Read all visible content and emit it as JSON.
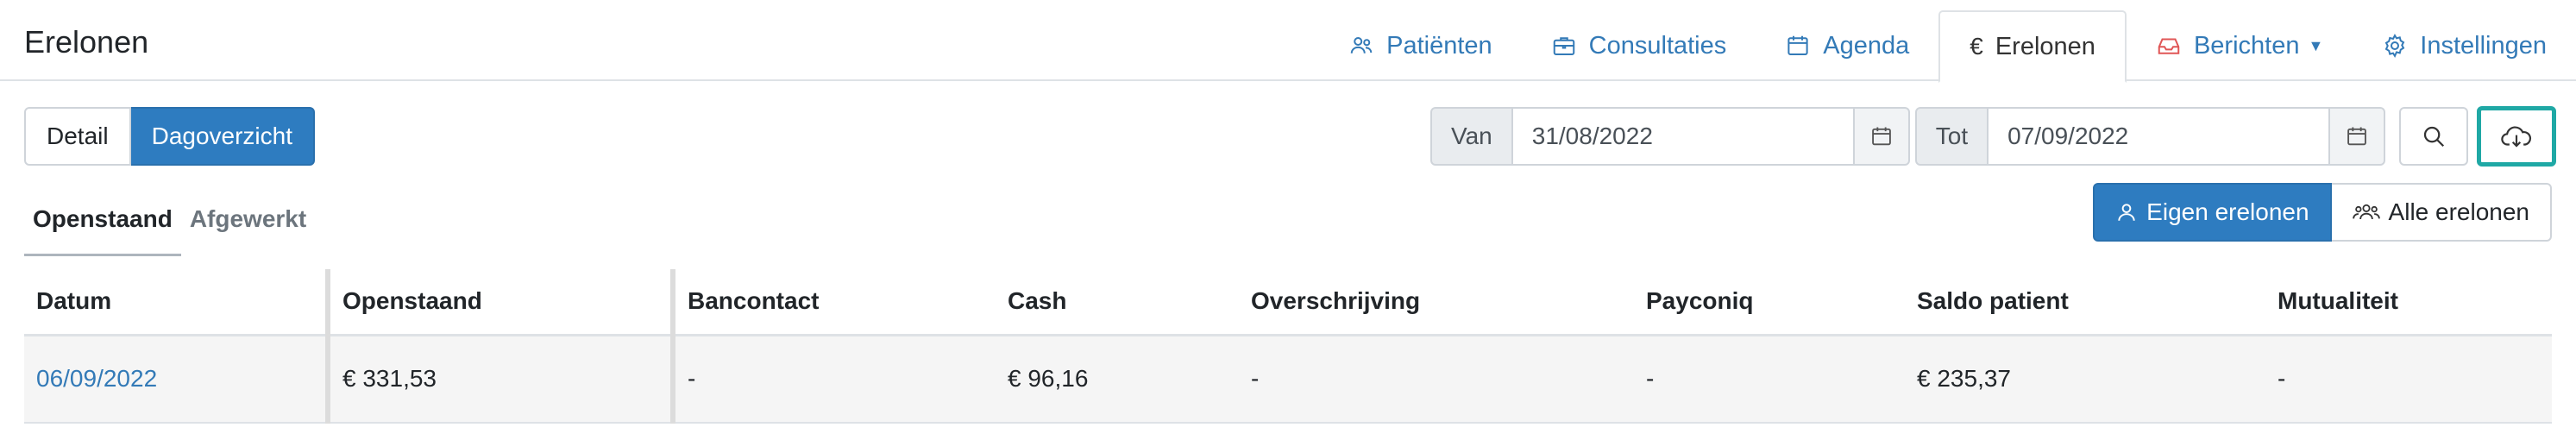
{
  "page": {
    "title": "Erelonen"
  },
  "nav": {
    "tabs": [
      {
        "label": "Patiënten",
        "icon": "users-icon"
      },
      {
        "label": "Consultaties",
        "icon": "briefcase-icon"
      },
      {
        "label": "Agenda",
        "icon": "calendar-icon"
      },
      {
        "label": "Erelonen",
        "icon": "euro-icon",
        "active": true
      },
      {
        "label": "Berichten",
        "icon": "inbox-icon",
        "dropdown": true
      },
      {
        "label": "Instellingen",
        "icon": "gear-icon"
      }
    ]
  },
  "view": {
    "detail_label": "Detail",
    "day_label": "Dagoverzicht",
    "selected": "Dagoverzicht"
  },
  "filter": {
    "from_label": "Van",
    "from_value": "31/08/2022",
    "to_label": "Tot",
    "to_value": "07/09/2022"
  },
  "subtabs": {
    "open_label": "Openstaand",
    "done_label": "Afgewerkt",
    "selected": "Openstaand"
  },
  "scope": {
    "own_label": "Eigen erelonen",
    "all_label": "Alle erelonen",
    "selected": "Eigen erelonen"
  },
  "table": {
    "headers": [
      "Datum",
      "Openstaand",
      "Bancontact",
      "Cash",
      "Overschrijving",
      "Payconiq",
      "Saldo patient",
      "Mutualiteit"
    ],
    "rows": [
      [
        "06/09/2022",
        "€ 331,53",
        "-",
        "€ 96,16",
        "-",
        "-",
        "€ 235,37",
        "-"
      ]
    ]
  },
  "colors": {
    "accent": "#2e7cc0",
    "link": "#337ab7",
    "highlight": "#1fa8a5",
    "mail": "#e05555"
  }
}
